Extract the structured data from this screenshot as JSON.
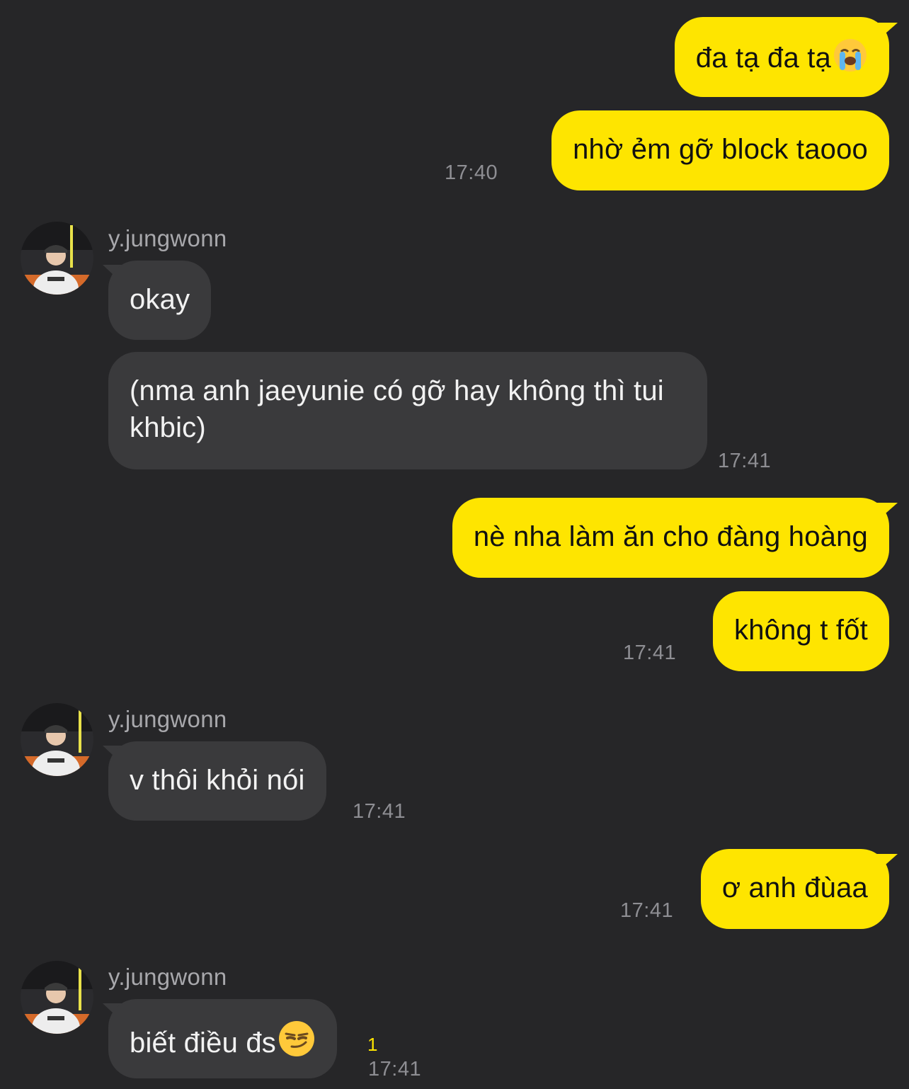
{
  "contact": {
    "name": "y.jungwonn"
  },
  "messages": [
    {
      "side": "out",
      "text": "đa tạ đa tạ",
      "emoji": "loudly-crying-face-icon"
    },
    {
      "side": "out",
      "text": "nhờ ẻm gỡ block taooo",
      "time": "17:40"
    },
    {
      "side": "in",
      "sender": "y.jungwonn",
      "text": "okay"
    },
    {
      "side": "in",
      "text": "(nma anh jaeyunie có gỡ hay không thì tui khbic)",
      "time": "17:41"
    },
    {
      "side": "out",
      "text": "nè nha làm ăn cho đàng hoàng"
    },
    {
      "side": "out",
      "text": "không t fốt",
      "time": "17:41"
    },
    {
      "side": "in",
      "sender": "y.jungwonn",
      "text": "v thôi khỏi nói",
      "time": "17:41"
    },
    {
      "side": "out",
      "text": "ơ anh đùaa",
      "time": "17:41"
    },
    {
      "side": "in",
      "sender": "y.jungwonn",
      "text": "biết điều đs",
      "emoji": "smirking-face-icon",
      "time": "17:41",
      "unread": "1"
    }
  ],
  "colors": {
    "background": "#262628",
    "outgoing_bubble": "#FEE500",
    "incoming_bubble": "#3A3A3C",
    "timestamp": "#8E8E93",
    "unread_count": "#FEE500"
  }
}
